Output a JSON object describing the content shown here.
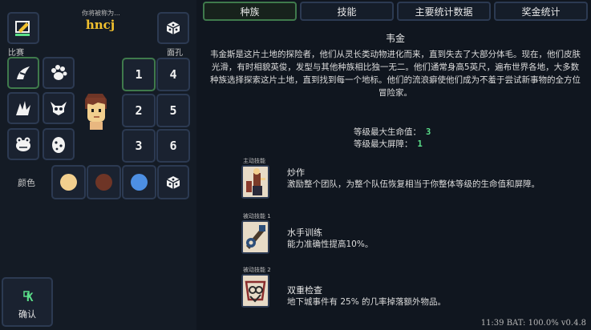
{
  "header": {
    "prompt": "你将被称为...",
    "player_name": "hncj"
  },
  "left": {
    "label_left": "比赛",
    "label_right": "面孔",
    "numbers": [
      "1",
      "2",
      "3",
      "4",
      "5",
      "6"
    ],
    "color_label": "颜色",
    "colors": [
      "#f2cf8e",
      "#6e3526",
      "#4d8fe3"
    ],
    "confirm_label": "确认",
    "confirm_key": "K"
  },
  "tabs": [
    "种族",
    "技能",
    "主要统计数据",
    "奖金统计"
  ],
  "race": {
    "name": "韦金",
    "description": "韦金斯是这片土地的探险者，他们从灵长类动物进化而来，直到失去了大部分体毛。现在，他们皮肤光滑，有时相貌英俊，发型与其他种族相比独一无二。他们通常身高5英尺，遍布世界各地，大多数种族选择探索这片土地，直到找到每一个地标。他们的流浪癖使他们成为不羞于尝试新事物的全方位冒险家。",
    "stats": [
      {
        "label": "等级最大生命值：",
        "value": "3"
      },
      {
        "label": "等级最大屏障：",
        "value": "1"
      }
    ]
  },
  "skills": [
    {
      "caption": "主动技能",
      "name": "炒作",
      "desc": "激励整个团队，为整个队伍恢复相当于你整体等级的生命值和屏障。"
    },
    {
      "caption": "被动技能 1",
      "name": "水手训练",
      "desc": "能力准确性提高10%。"
    },
    {
      "caption": "被动技能 2",
      "name": "双重检查",
      "desc": "地下城事件有 25% 的几率掉落额外物品。"
    }
  ],
  "footer": "11:39 BAT: 100.0% v0.4.8"
}
